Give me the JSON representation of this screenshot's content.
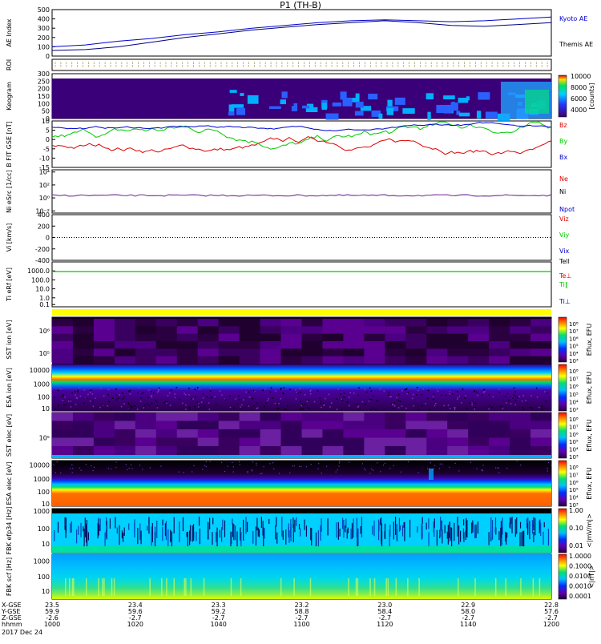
{
  "title": "P1 (TH-B)",
  "date_label": "2017 Dec 24",
  "colors": {
    "red": "#e00000",
    "green": "#00c800",
    "blue": "#0000d0",
    "black": "#000000",
    "yellow": "#ffff00",
    "cyan": "#00d8ff",
    "ae_line": "#000080"
  },
  "footer": {
    "row_labels": [
      "X-GSE",
      "Y-GSE",
      "Z-GSE",
      "hhmm"
    ],
    "columns": [
      {
        "x": "23.5",
        "y": "59.9",
        "z": "-2.6",
        "t": "1000"
      },
      {
        "x": "23.4",
        "y": "59.6",
        "z": "-2.7",
        "t": "1020"
      },
      {
        "x": "23.3",
        "y": "59.2",
        "z": "-2.7",
        "t": "1040"
      },
      {
        "x": "23.2",
        "y": "58.8",
        "z": "-2.7",
        "t": "1100"
      },
      {
        "x": "23.0",
        "y": "58.4",
        "z": "-2.7",
        "t": "1120"
      },
      {
        "x": "22.9",
        "y": "58.0",
        "z": "-2.7",
        "t": "1140"
      },
      {
        "x": "22.8",
        "y": "57.6",
        "z": "-2.7",
        "t": "1200"
      }
    ]
  },
  "chart_data": [
    {
      "id": "ae",
      "type": "line",
      "ylabel": "AE Index",
      "yticks": [
        "500",
        "400",
        "300",
        "200",
        "100",
        "0"
      ],
      "ylim": [
        0,
        500
      ],
      "series": [
        {
          "name": "Kyoto AE",
          "x": [
            0,
            8,
            16,
            24,
            32,
            40,
            48,
            56,
            64,
            72,
            80,
            88,
            96,
            104,
            112,
            120
          ],
          "values": [
            100,
            120,
            160,
            190,
            230,
            260,
            300,
            330,
            360,
            380,
            390,
            380,
            370,
            380,
            400,
            420
          ]
        },
        {
          "name": "Themis AE",
          "x": [
            0,
            8,
            16,
            24,
            32,
            40,
            48,
            56,
            64,
            72,
            80,
            88,
            96,
            104,
            112,
            120
          ],
          "values": [
            60,
            70,
            100,
            150,
            200,
            240,
            280,
            310,
            340,
            360,
            380,
            360,
            330,
            320,
            340,
            360
          ]
        }
      ]
    },
    {
      "id": "roi",
      "type": "table",
      "ylabel": "ROI"
    },
    {
      "id": "keogram",
      "type": "heatmap",
      "ylabel": "Keogram",
      "yticks": [
        "300",
        "250",
        "200",
        "150",
        "100",
        "50",
        "0"
      ],
      "colorbar_ticks": [
        "10000",
        "8000",
        "6000",
        "4000"
      ],
      "colorbar_label": "[counts]"
    },
    {
      "id": "bfield",
      "type": "line",
      "ylabel": "B FIT GSE [nT]",
      "yticks": [
        "10",
        "5",
        "0",
        "-5",
        "-10",
        "-15"
      ],
      "ylim": [
        -15,
        10
      ],
      "series": [
        {
          "name": "Bz",
          "color": "red"
        },
        {
          "name": "By",
          "color": "green"
        },
        {
          "name": "Bx",
          "color": "blue"
        }
      ]
    },
    {
      "id": "density",
      "type": "line",
      "ylabel": "Ni eSrc [1/cc]",
      "yticks": [
        "10⁴",
        "10²",
        "10⁰",
        "10⁻²"
      ],
      "series": [
        {
          "name": "Ne"
        },
        {
          "name": "Ni"
        },
        {
          "name": "Npot"
        }
      ]
    },
    {
      "id": "velocity",
      "type": "line",
      "ylabel": "Vi [km/s]",
      "yticks": [
        "400",
        "200",
        "0",
        "-200",
        "-400"
      ],
      "ylim": [
        -400,
        400
      ],
      "series": [
        {
          "name": "Viz"
        },
        {
          "name": "Viy"
        },
        {
          "name": "Vix"
        }
      ]
    },
    {
      "id": "temp",
      "type": "line",
      "ylabel": "Ti eRf [eV]",
      "yticks": [
        "1000.0",
        "100.0",
        "10.0",
        "1.0",
        "0.1"
      ],
      "series": [
        {
          "name": "Tell"
        },
        {
          "name": "Te⊥"
        },
        {
          "name": "Ti∥"
        },
        {
          "name": "Ti⊥"
        }
      ]
    },
    {
      "id": "sst_i",
      "type": "heatmap",
      "ylabel": "SST ion [eV]",
      "yticks": [
        "10⁶",
        "10⁵"
      ],
      "colorbar_label": "Eflux, EFU"
    },
    {
      "id": "esa_i",
      "type": "heatmap",
      "ylabel": "ESA ion [eV]",
      "yticks": [
        "10000",
        "1000",
        "100",
        "10"
      ],
      "colorbar_label": "Eflux, EFU"
    },
    {
      "id": "sst_e",
      "type": "heatmap",
      "ylabel": "SST elec [eV]",
      "yticks": [
        "10⁵"
      ],
      "colorbar_label": "Eflux, EFU"
    },
    {
      "id": "esa_e",
      "type": "heatmap",
      "ylabel": "ESA elec [eV]",
      "yticks": [
        "10000",
        "1000",
        "100",
        "10"
      ],
      "colorbar_label": "Eflux, EFU"
    },
    {
      "id": "fbk_e",
      "type": "heatmap",
      "ylabel": "FBK efp34 [Hz]",
      "yticks": [
        "1000",
        "100",
        "10"
      ],
      "colorbar_ticks": [
        "1.00",
        "0.10",
        "0.01"
      ],
      "colorbar_label": "<|mV/m|>"
    },
    {
      "id": "fbk_b",
      "type": "heatmap",
      "ylabel": "FBK scf [Hz]",
      "yticks": [
        "1000",
        "100",
        "10"
      ],
      "colorbar_ticks": [
        "1.0000",
        "0.1000",
        "0.0100",
        "0.0010",
        "0.0001"
      ],
      "colorbar_label": "<|nT|>"
    }
  ],
  "eflux_ticks": [
    "10⁸",
    "10⁷",
    "10⁶",
    "10⁵",
    "10⁴",
    "10³"
  ]
}
